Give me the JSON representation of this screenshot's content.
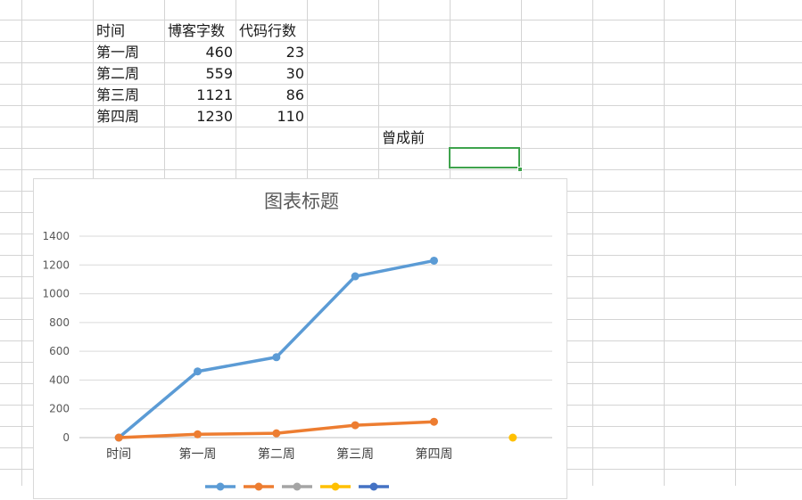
{
  "sheet": {
    "headers": [
      "时间",
      "博客字数",
      "代码行数"
    ],
    "rows": [
      [
        "第一周",
        "460",
        "23"
      ],
      [
        "第二周",
        "559",
        "30"
      ],
      [
        "第三周",
        "1121",
        "86"
      ],
      [
        "第四周",
        "1230",
        "110"
      ]
    ],
    "note": "曾成前",
    "selected_cell_color": "#3fa34d",
    "grid_color": "#d4d4d4"
  },
  "chart_data": {
    "type": "line",
    "title": "图表标题",
    "categories": [
      "时间",
      "第一周",
      "第二周",
      "第三周",
      "第四周",
      ""
    ],
    "series": [
      {
        "values": [
          0,
          460,
          559,
          1121,
          1230,
          null
        ],
        "color": "#5b9bd5"
      },
      {
        "values": [
          0,
          23,
          30,
          86,
          110,
          null
        ],
        "color": "#ed7d31"
      },
      {
        "values": [
          null,
          null,
          null,
          null,
          null,
          null
        ],
        "color": "#a5a5a5"
      },
      {
        "values": [
          null,
          null,
          null,
          null,
          null,
          0
        ],
        "color": "#ffc000"
      },
      {
        "values": [
          null,
          null,
          null,
          null,
          null,
          null
        ],
        "color": "#4472c4"
      }
    ],
    "yticks": [
      0,
      200,
      400,
      600,
      800,
      1000,
      1200,
      1400
    ],
    "ylim": [
      0,
      1400
    ],
    "grid": true,
    "legend": "bottom",
    "xlabel": "",
    "ylabel": ""
  }
}
